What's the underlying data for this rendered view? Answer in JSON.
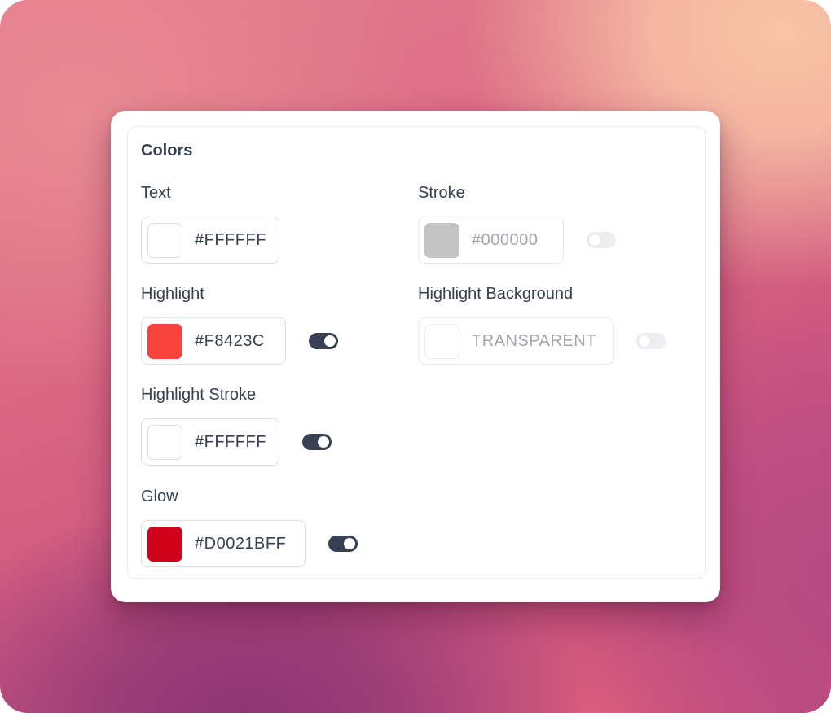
{
  "section": {
    "title": "Colors"
  },
  "fields": {
    "text": {
      "label": "Text",
      "value": "#FFFFFF",
      "swatch": "#FFFFFF"
    },
    "stroke": {
      "label": "Stroke",
      "value": "#000000",
      "swatch": "#C3C3C3",
      "enabled": false
    },
    "highlight": {
      "label": "Highlight",
      "value": "#F8423C",
      "swatch": "#F8423C",
      "enabled": true
    },
    "highlight_background": {
      "label": "Highlight Background",
      "value": "TRANSPARENT",
      "swatch": "#FFFFFF",
      "enabled": false
    },
    "highlight_stroke": {
      "label": "Highlight Stroke",
      "value": "#FFFFFF",
      "swatch": "#FFFFFF",
      "enabled": true
    },
    "glow": {
      "label": "Glow",
      "value": "#D0021BFF",
      "swatch": "#D0021B",
      "enabled": true
    }
  },
  "colors": {
    "toggle_on": "#374151",
    "toggle_off": "#ECEEF1",
    "text": "#374151"
  }
}
